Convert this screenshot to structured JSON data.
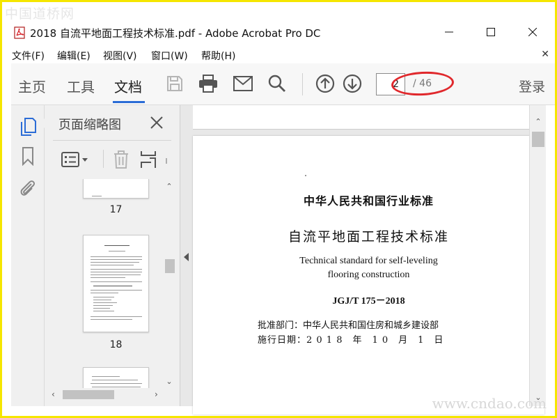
{
  "watermarks": {
    "top": "中国道桥网",
    "bottom": "www.cndao.com"
  },
  "window": {
    "title": "2018 自流平地面工程技术标准.pdf - Adobe Acrobat Pro DC"
  },
  "menu": {
    "items": [
      "文件(F)",
      "编辑(E)",
      "视图(V)",
      "窗口(W)",
      "帮助(H)"
    ]
  },
  "toolbar": {
    "tabs": [
      "主页",
      "工具",
      "文档"
    ],
    "active_tab": "文档",
    "page_current": "2",
    "page_total": "/ 46",
    "login": "登录",
    "accent_color": "#2b6cd6",
    "highlight_color": "#e0282c"
  },
  "panel": {
    "title": "页面缩略图",
    "thumbnails": [
      {
        "page": "17"
      },
      {
        "page": "18"
      }
    ]
  },
  "document": {
    "title_cn": "中华人民共和国行业标准",
    "subtitle_cn": "自流平地面工程技术标准",
    "title_en_1": "Technical standard for self-leveling",
    "title_en_2": "flooring construction",
    "code": "JGJ/T 175－2018",
    "approval": "批准部门：中华人民共和国住房和城乡建设部",
    "effective": "施行日期：2 0 1 8　年　1 0　月　1　日"
  }
}
